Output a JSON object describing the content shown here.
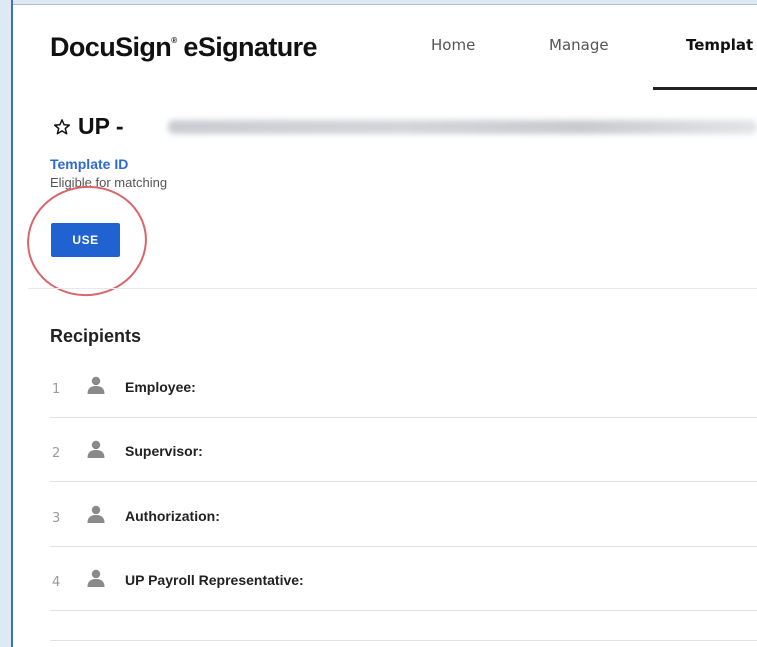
{
  "header": {
    "logo": "DocuSign",
    "logo_tm": "®",
    "logo_suffix": " eSignature",
    "nav": [
      {
        "label": "Home"
      },
      {
        "label": "Manage"
      },
      {
        "label": "Templat",
        "active": true
      }
    ]
  },
  "template": {
    "title_prefix": "UP -",
    "template_id_label": "Template ID",
    "eligible_text": "Eligible for matching",
    "use_button_label": "USE"
  },
  "recipients": {
    "heading": "Recipients",
    "items": [
      {
        "number": "1",
        "label": "Employee:"
      },
      {
        "number": "2",
        "label": "Supervisor:"
      },
      {
        "number": "3",
        "label": "Authorization:"
      },
      {
        "number": "4",
        "label": "UP Payroll Representative:"
      }
    ]
  },
  "colors": {
    "accent": "#2162d1",
    "link": "#2d6ad2",
    "annotation": "#d9676a",
    "icon_gray": "#8a8a8a"
  },
  "icons": [
    "star-outline-icon",
    "person-icon"
  ]
}
